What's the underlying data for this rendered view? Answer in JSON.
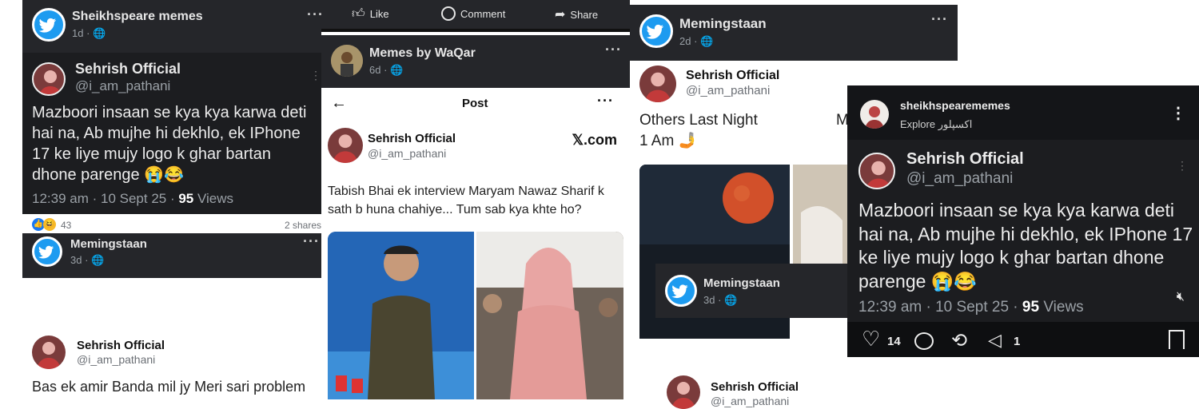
{
  "panel1": {
    "page_name": "Sheikhspeare memes",
    "page_age": "1d",
    "tweet": {
      "name": "Sehrish Official",
      "handle": "@i_am_pathani",
      "text": "Mazboori insaan se kya kya karwa deti hai na, Ab mujhe hi dekhlo, ek IPhone 17 ke liye mujy logo k ghar bartan dhone parenge 😭😂",
      "time": "12:39 am · 10 Sept 25 · ",
      "views_count": "95",
      "views_label": " Views"
    },
    "reactions_count": "43",
    "shares": "2 shares",
    "page2_name": "Memingstaan",
    "page2_age": "3d",
    "tweet2": {
      "name": "Sehrish Official",
      "handle": "@i_am_pathani",
      "text": "Bas ek amir Banda mil jy Meri sari problem"
    }
  },
  "panel2": {
    "actions": {
      "like": "Like",
      "comment": "Comment",
      "share": "Share"
    },
    "page_name": "Memes by WaQar",
    "page_age": "6d",
    "post_header": "Post",
    "tweet": {
      "name": "Sehrish Official",
      "handle": "@i_am_pathani",
      "site": "𝕏.com",
      "text": "Tabish Bhai ek interview Maryam Nawaz Sharif k sath b huna chahiye... Tum sab kya khte ho?"
    }
  },
  "panel3": {
    "page_name": "Memingstaan",
    "page_age": "2d",
    "tweet": {
      "name": "Sehrish Official",
      "handle": "@i_am_pathani",
      "text_line1": "Others Last Night",
      "text_line2": "1 Am 🤳",
      "cut_letter": "M"
    },
    "inner_page_name": "Memingstaan",
    "inner_page_age": "3d",
    "bottom_name": "Sehrish Official",
    "bottom_handle": "@i_am_pathani"
  },
  "panel4": {
    "account": "sheikhspearememes",
    "explore": "Explore اکسپلور",
    "tweet": {
      "name": "Sehrish Official",
      "handle": "@i_am_pathani",
      "text": "Mazboori insaan se kya kya karwa deti hai na, Ab mujhe hi dekhlo, ek IPhone 17 ke liye mujy logo k ghar bartan dhone parenge 😭😂",
      "time": "12:39 am · 10 Sept 25 · ",
      "views_count": "95",
      "views_label": " Views"
    },
    "likes": "14",
    "sends": "1"
  }
}
